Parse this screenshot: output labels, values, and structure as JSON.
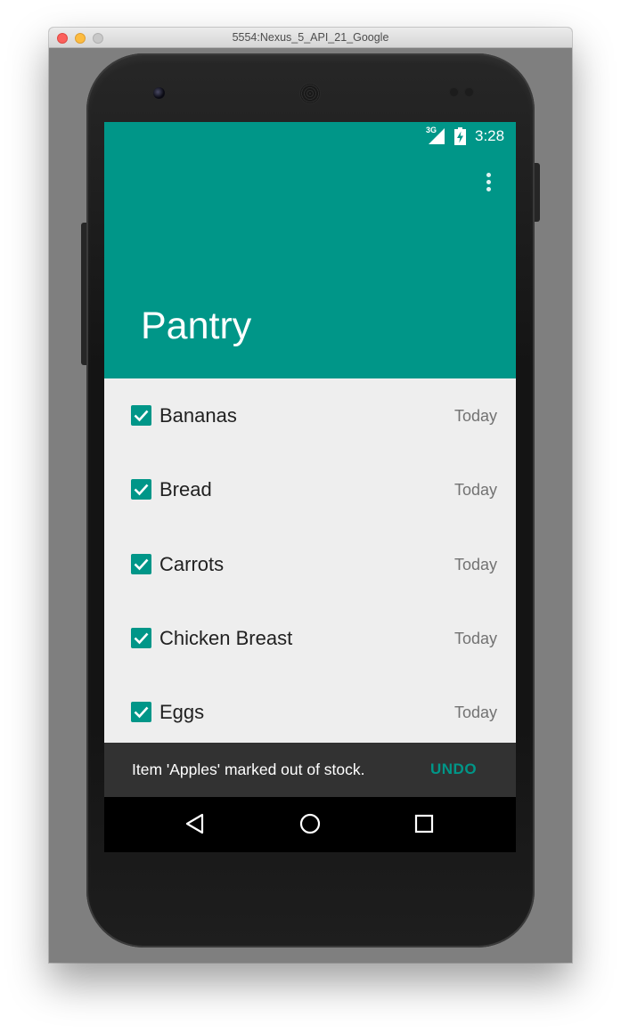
{
  "window": {
    "title": "5554:Nexus_5_API_21_Google"
  },
  "status_bar": {
    "network_type": "3G",
    "time": "3:28",
    "icons": [
      "signal-icon",
      "battery-charging-icon"
    ]
  },
  "appbar": {
    "title": "Pantry",
    "color": "#009688",
    "menu_icon": "overflow-menu-icon"
  },
  "items": [
    {
      "name": "Bananas",
      "date": "Today",
      "checked": true
    },
    {
      "name": "Bread",
      "date": "Today",
      "checked": true
    },
    {
      "name": "Carrots",
      "date": "Today",
      "checked": true
    },
    {
      "name": "Chicken Breast",
      "date": "Today",
      "checked": true
    },
    {
      "name": "Eggs",
      "date": "Today",
      "checked": true
    }
  ],
  "snackbar": {
    "message": "Item 'Apples' marked out of stock.",
    "action": "UNDO"
  },
  "nav_bar": {
    "icons": [
      "back-icon",
      "home-icon",
      "recents-icon"
    ]
  },
  "colors": {
    "accent": "#009688",
    "list_background": "#eeeeee",
    "snackbar": "#323232"
  }
}
